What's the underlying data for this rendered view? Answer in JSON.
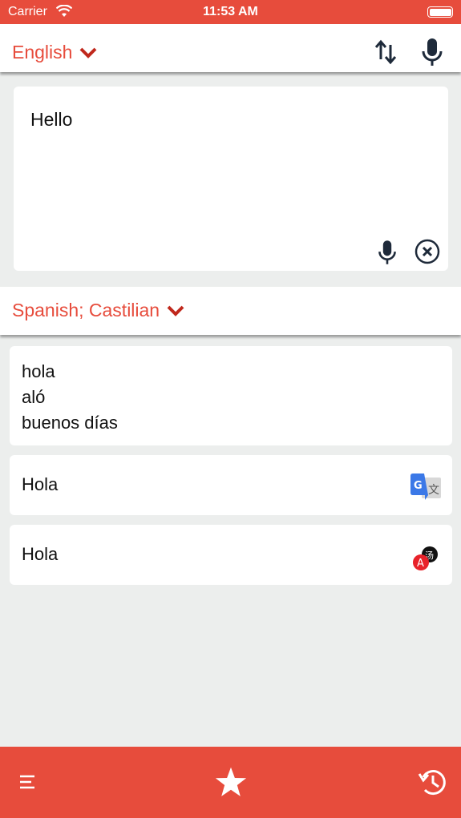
{
  "status_bar": {
    "carrier": "Carrier",
    "time": "11:53 AM"
  },
  "source": {
    "language": "English",
    "text": "Hello"
  },
  "target": {
    "language": "Spanish; Castilian"
  },
  "results": {
    "dictionary": [
      "hola",
      "aló",
      "buenos días"
    ],
    "google": {
      "text": "Hola",
      "provider_icon": "google-translate-icon"
    },
    "other": {
      "text": "Hola",
      "provider_icon": "translator-app-icon"
    }
  },
  "colors": {
    "accent": "#e74c3c",
    "icon_dark": "#1e2a3a",
    "background": "#eceeed"
  }
}
